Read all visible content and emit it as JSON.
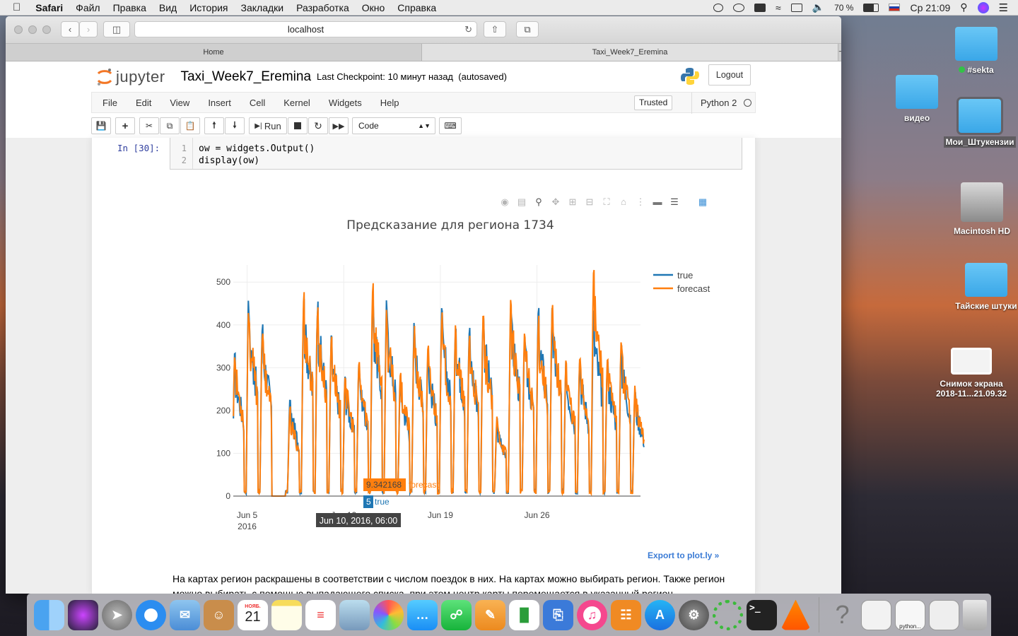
{
  "menubar": {
    "app": "Safari",
    "items": [
      "Файл",
      "Правка",
      "Вид",
      "История",
      "Закладки",
      "Разработка",
      "Окно",
      "Справка"
    ],
    "battery": "70 %",
    "clock": "Ср 21:09"
  },
  "browser": {
    "url": "localhost",
    "tabs": [
      "Home",
      "Taxi_Week7_Eremina"
    ]
  },
  "jupyter": {
    "logo": "jupyter",
    "notebook_name": "Taxi_Week7_Eremina",
    "checkpoint": "Last Checkpoint: 10 минут назад",
    "autosaved": "(autosaved)",
    "logout": "Logout",
    "menu": [
      "File",
      "Edit",
      "View",
      "Insert",
      "Cell",
      "Kernel",
      "Widgets",
      "Help"
    ],
    "trusted": "Trusted",
    "kernel": "Python 2",
    "run_label": "Run",
    "cell_type": "Code"
  },
  "cell": {
    "prompt": "In [30]:",
    "lines": [
      "1",
      "2"
    ],
    "code": [
      "ow = widgets.Output()",
      "display(ow)"
    ]
  },
  "chart_data": {
    "type": "line",
    "title": "Предсказание для региона 1734",
    "xlabel": "",
    "ylabel": "",
    "x_tick_labels": [
      "Jun 5\n2016",
      "Jun 12",
      "Jun 19",
      "Jun 26"
    ],
    "x_range_days": [
      0,
      29.5
    ],
    "ylim": [
      0,
      540
    ],
    "y_ticks": [
      0,
      100,
      200,
      300,
      400,
      500
    ],
    "grid": true,
    "legend_position": "top-right",
    "series": [
      {
        "name": "true",
        "color": "#1f77b4",
        "daily_peaks": [
          320,
          440,
          390,
          0,
          220,
          450,
          440,
          360,
          270,
          300,
          450,
          440,
          270,
          390,
          330,
          420,
          400,
          380,
          420,
          170,
          440,
          370,
          420,
          420,
          300,
          310,
          420,
          310,
          350,
          240
        ]
      },
      {
        "name": "forecast",
        "color": "#ff7f0e",
        "daily_peaks": [
          330,
          430,
          380,
          0,
          200,
          460,
          430,
          370,
          280,
          310,
          490,
          420,
          290,
          380,
          340,
          410,
          390,
          370,
          400,
          180,
          450,
          380,
          410,
          430,
          310,
          320,
          510,
          320,
          360,
          250
        ]
      }
    ],
    "hover": {
      "x_label": "Jun 10, 2016, 06:00",
      "forecast_value": "9.342168",
      "true_value": "5"
    },
    "export_label": "Export to plot.ly »"
  },
  "markdown_text": "На картах регион раскрашены в соответствии с числом поездок в них. На картах можно выбирать регион. Также регион можно выбирать с помощью выпадающего списка, при этом центр карты перемещается в указанный регион.",
  "desktop": {
    "items": [
      "#sekta",
      "видео",
      "Мои_Штукензии",
      "Macintosh HD",
      "Тайские штуки",
      "Снимок экрана 2018-11...21.09.32"
    ]
  },
  "dock": {
    "calendar_month": "НОЯБ.",
    "calendar_day": "21",
    "terminal_label": ">_",
    "help_glyph": "?",
    "python_label": "python..."
  }
}
